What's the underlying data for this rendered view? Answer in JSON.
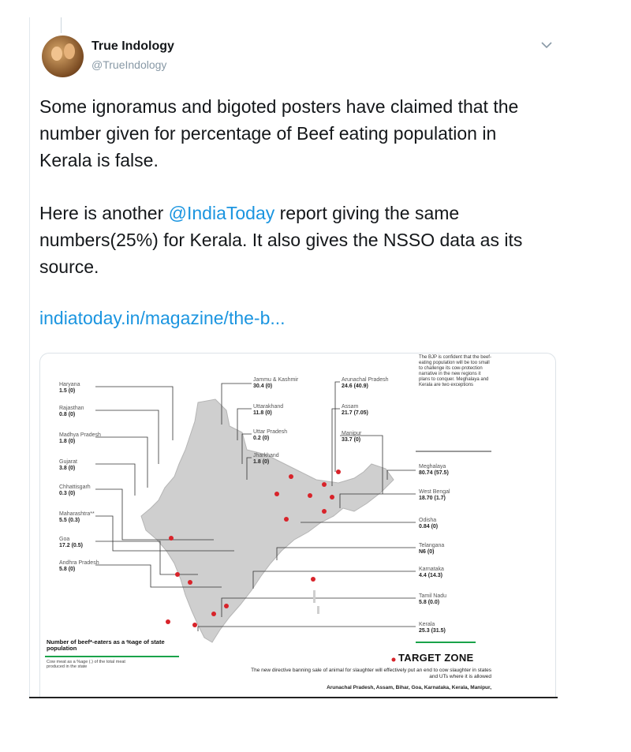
{
  "tweet": {
    "display_name": "True Indology",
    "handle": "@TrueIndology",
    "text_p1": "Some ignoramus and bigoted posters have claimed that the number given for percentage of Beef eating population in Kerala is false.",
    "text_p2_before": "Here is another ",
    "text_p2_mention": "@IndiaToday",
    "text_p2_after": "  report giving the same numbers(25%) for Kerala. It also gives the NSSO data as its source.",
    "link": "indiatoday.in/magazine/the-b..."
  },
  "card": {
    "left_labels": [
      {
        "name": "Haryana",
        "value": "1.5",
        "suffix": "(0)"
      },
      {
        "name": "Rajasthan",
        "value": "0.8",
        "suffix": "(0)"
      },
      {
        "name": "Madhya Pradesh",
        "value": "1.8",
        "suffix": "(0)"
      },
      {
        "name": "Gujarat",
        "value": "3.8",
        "suffix": "(0)"
      },
      {
        "name": "Chhattisgarh",
        "value": "0.3",
        "suffix": "(0)"
      },
      {
        "name": "Maharashtra**",
        "value": "5.5",
        "suffix": "(0.3)"
      },
      {
        "name": "Goa",
        "value": "17.2",
        "suffix": "(0.5)"
      },
      {
        "name": "Andhra Pradesh",
        "value": "5.8",
        "suffix": "(0)"
      }
    ],
    "top_labels": [
      {
        "name": "Jammu & Kashmir",
        "value": "30.4",
        "suffix": "(0)"
      },
      {
        "name": "Uttarakhand",
        "value": "11.8",
        "suffix": "(0)"
      },
      {
        "name": "Uttar Pradesh",
        "value": "0.2",
        "suffix": "(0)"
      },
      {
        "name": "Jharkhand",
        "value": "1.8",
        "suffix": "(0)"
      },
      {
        "name": "Arunachal Pradesh",
        "value": "24.6",
        "suffix": "(40.9)"
      },
      {
        "name": "Assam",
        "value": "21.7",
        "suffix": "(7.05)"
      },
      {
        "name": "Manipur",
        "value": "33.7",
        "suffix": "(0)"
      }
    ],
    "right_labels": [
      {
        "name": "Meghalaya",
        "value": "80.74",
        "suffix": "(57.5)"
      },
      {
        "name": "West Bengal",
        "value": "18.70",
        "suffix": "(1.7)"
      },
      {
        "name": "Odisha",
        "value": "0.84",
        "suffix": "(0)"
      },
      {
        "name": "Telangana",
        "value": "N6",
        "suffix": "(0)"
      },
      {
        "name": "Karnataka",
        "value": "4.4",
        "suffix": "(14.3)"
      },
      {
        "name": "Tamil Nadu",
        "value": "5.8",
        "suffix": "(0.0)"
      },
      {
        "name": "Kerala",
        "value": "25.3",
        "suffix": "(31.5)"
      }
    ],
    "sidebar_note": "The BJP is confident that the beef-eating population will be too small to challenge its cow-protection narrative in the new regions it plans to conquer. Meghalaya and Kerala are two exceptions",
    "legend_title": "Number of beef*-eaters as a %age of state population",
    "legend_note": "Cow meat as a %age (.) of the total meat produced in the state",
    "target_zone": "TARGET ZONE",
    "bottom_text": "The new directive banning sale of animal for slaughter will effectively put an end to cow slaughter in states and UTs where it is allowed",
    "bottom_states": "Arunachal Pradesh, Assam, Bihar, Goa, Karnataka, Kerala, Manipur,"
  },
  "colors": {
    "link": "#1b95e0",
    "dot": "#d8232a",
    "map": "#cfcfcf",
    "accent_green": "#1aa34a"
  },
  "icons": {
    "menu": "chevron-down-icon"
  }
}
